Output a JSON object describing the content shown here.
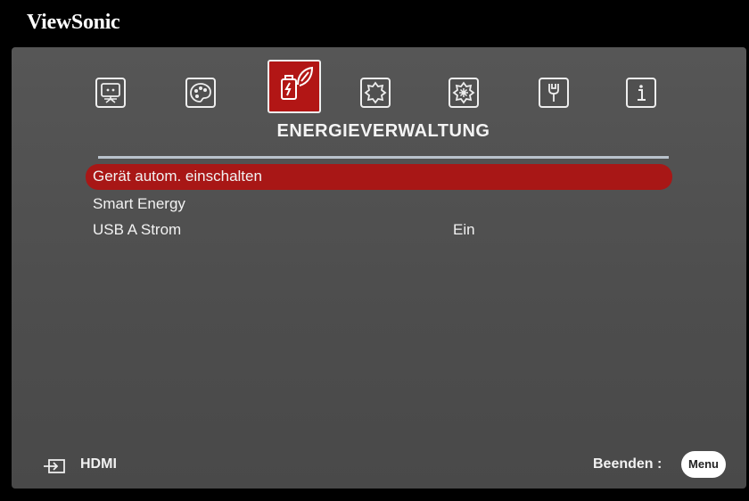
{
  "brand": "ViewSonic",
  "tabs": [
    {
      "name": "display-icon"
    },
    {
      "name": "image-settings-icon"
    },
    {
      "name": "power-management-icon",
      "active": true
    },
    {
      "name": "basic-settings-icon"
    },
    {
      "name": "advanced-settings-icon"
    },
    {
      "name": "system-tools-icon"
    },
    {
      "name": "information-icon"
    }
  ],
  "tab_title": "ENERGIEVERWALTUNG",
  "menu": {
    "items": [
      {
        "label": "Gerät autom. einschalten",
        "value": "",
        "selected": true
      },
      {
        "label": "Smart Energy",
        "value": ""
      },
      {
        "label": "USB A Strom",
        "value": "Ein"
      }
    ]
  },
  "footer": {
    "source": "HDMI",
    "exit_label": "Beenden :",
    "menu_button": "Menu"
  },
  "colors": {
    "accent": "#b21615",
    "panel": "#525252",
    "divider": "#b9c2cc"
  }
}
